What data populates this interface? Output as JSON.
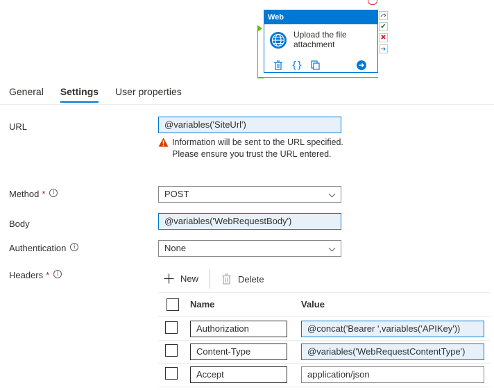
{
  "canvas": {
    "activity": {
      "type_label": "Web",
      "name": "Upload the file attachment"
    }
  },
  "tabs": [
    {
      "label": "General"
    },
    {
      "label": "Settings"
    },
    {
      "label": "User properties"
    }
  ],
  "active_tab": "Settings",
  "form": {
    "url_label": "URL",
    "url_value": "@variables('SiteUrl')",
    "url_warning": "Information will be sent to the URL specified. Please ensure you trust the URL entered.",
    "method_label": "Method",
    "method_value": "POST",
    "body_label": "Body",
    "body_value": "@variables('WebRequestBody')",
    "auth_label": "Authentication",
    "auth_value": "None",
    "headers_label": "Headers",
    "required_mark": "*",
    "info_glyph": "i"
  },
  "headers": {
    "new_label": "New",
    "delete_label": "Delete",
    "col_name": "Name",
    "col_value": "Value",
    "rows": [
      {
        "name": "Authorization",
        "value": "@concat('Bearer ',variables('APIKey'))"
      },
      {
        "name": "Content-Type",
        "value": "@variables('WebRequestContentType')"
      },
      {
        "name": "Accept",
        "value": "application/json"
      }
    ]
  },
  "colors": {
    "accent": "#0078d4",
    "success": "#6bb700",
    "error": "#a4262c",
    "warning": "#d83b01"
  }
}
